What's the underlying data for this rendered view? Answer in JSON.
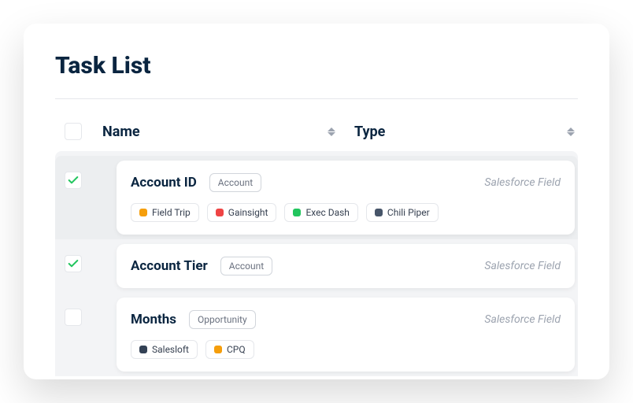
{
  "title": "Task List",
  "columns": {
    "name": "Name",
    "type": "Type"
  },
  "tagColors": {
    "Field Trip": "#f59e0b",
    "Gainsight": "#ef4444",
    "Exec Dash": "#22c55e",
    "Chili Piper": "#475569",
    "Salesloft": "#334155",
    "CPQ": "#f59e0b"
  },
  "tasks": [
    {
      "name": "Account ID",
      "category": "Account",
      "type": "Salesforce Field",
      "checked": true,
      "tags": [
        "Field Trip",
        "Gainsight",
        "Exec Dash",
        "Chili Piper"
      ]
    },
    {
      "name": "Account Tier",
      "category": "Account",
      "type": "Salesforce Field",
      "checked": true,
      "tags": []
    },
    {
      "name": "Months",
      "category": "Opportunity",
      "type": "Salesforce Field",
      "checked": false,
      "tags": [
        "Salesloft",
        "CPQ"
      ]
    }
  ]
}
